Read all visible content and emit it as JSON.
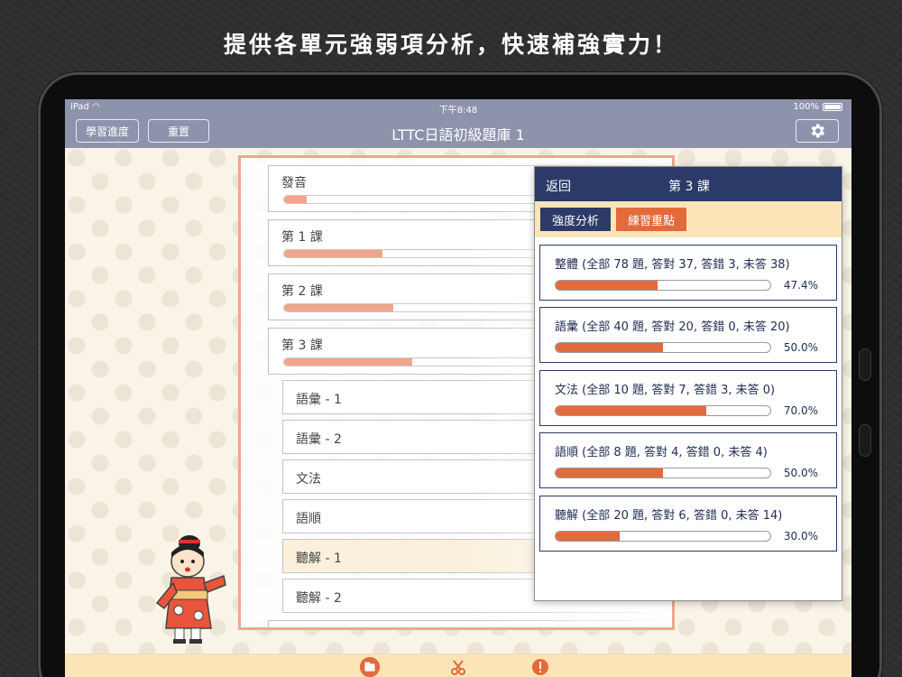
{
  "headline": "提供各單元強弱項分析，快速補強實力！",
  "status": {
    "device": "iPad",
    "time": "下午8:48",
    "battery": "100%"
  },
  "nav": {
    "progress_label": "學習進度",
    "reset_label": "重置",
    "title": "LTTC日語初級題庫 1",
    "settings_icon": "gear-icon"
  },
  "lessons": [
    {
      "name": "發音",
      "progress": 0.06
    },
    {
      "name": "第 1 課",
      "progress": 0.26
    },
    {
      "name": "第 2 課",
      "progress": 0.29
    },
    {
      "name": "第 3 課",
      "progress": 0.34
    }
  ],
  "sub_items": [
    {
      "name": "語彙 - 1"
    },
    {
      "name": "語彙 - 2"
    },
    {
      "name": "文法"
    },
    {
      "name": "語順"
    },
    {
      "name": "聽解 - 1",
      "selected": true
    },
    {
      "name": "聽解 - 2"
    }
  ],
  "popover": {
    "back_label": "返回",
    "title": "第 3 課",
    "tab_analysis": "強度分析",
    "tab_practice": "練習重點",
    "stats": [
      {
        "label": "整體 (全部 78 題, 答對 37, 答錯 3, 未答 38)",
        "percent": "47.4%",
        "value": 0.474
      },
      {
        "label": "語彙 (全部 40 題, 答對 20, 答錯 0, 未答 20)",
        "percent": "50.0%",
        "value": 0.5
      },
      {
        "label": "文法 (全部 10 題, 答對 7, 答錯 3, 未答 0)",
        "percent": "70.0%",
        "value": 0.7
      },
      {
        "label": "語順 (全部 8 題, 答對 4, 答錯 0, 未答 4)",
        "percent": "50.0%",
        "value": 0.5
      },
      {
        "label": "聽解 (全部 20 題, 答對 6, 答錯 0, 未答 14)",
        "percent": "30.0%",
        "value": 0.3
      }
    ]
  },
  "colors": {
    "nav": "#8d93ab",
    "navy": "#2b3a67",
    "orange": "#e36a3b",
    "peach": "#f1a58b",
    "cream": "#fbe5b8"
  }
}
